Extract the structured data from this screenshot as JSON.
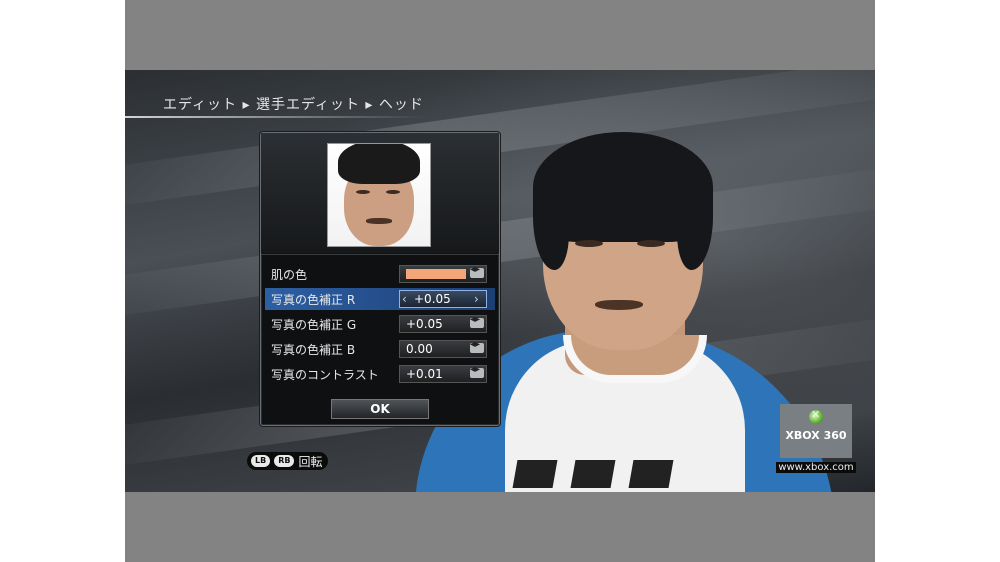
{
  "breadcrumb": "エディット ▸ 選手エディット ▸ ヘッド",
  "dialog": {
    "rows": [
      {
        "label": "肌の色",
        "value": ""
      },
      {
        "label": "写真の色補正 R",
        "value": "+0.05"
      },
      {
        "label": "写真の色補正 G",
        "value": "+0.05"
      },
      {
        "label": "写真の色補正 B",
        "value": "0.00"
      },
      {
        "label": "写真のコントラスト",
        "value": "+0.01"
      }
    ],
    "selected_index": 1,
    "skin_color": "#f2a67a",
    "ok_label": "OK"
  },
  "hint": {
    "lb": "LB",
    "rb": "RB",
    "label": "回転"
  },
  "branding": {
    "logo_text": "XBOX 360",
    "url": "www.xbox.com"
  },
  "colors": {
    "selection": "#2d5fa4",
    "shirt": "#2e74b8"
  }
}
